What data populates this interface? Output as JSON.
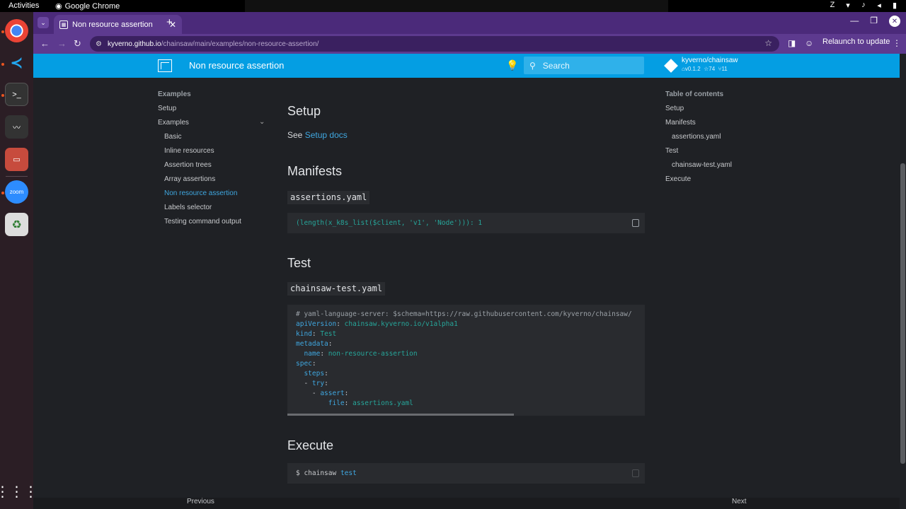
{
  "system_bar": {
    "activities": "Activities",
    "app_name": "Google Chrome"
  },
  "dock": {
    "apps": [
      "chrome-icon",
      "vscode-icon",
      "terminal-icon",
      "system-monitor-icon",
      "files-icon",
      "zoom-icon",
      "trash-icon",
      "show-apps-icon"
    ],
    "zoom_label": "zoom"
  },
  "browser": {
    "tab_title": "Non resource assertion",
    "url_host": "kyverno.github.io",
    "url_path": "/chainsaw/main/examples/non-resource-assertion/",
    "relaunch_label": "Relaunch to update"
  },
  "header": {
    "title": "Non resource assertion",
    "search_placeholder": "Search",
    "repo_name": "kyverno/chainsaw",
    "repo_version": "v0.1.2",
    "repo_stars": "74",
    "repo_forks": "11"
  },
  "left_nav": {
    "section": "Examples",
    "setup": "Setup",
    "examples": "Examples",
    "items": [
      {
        "label": "Basic"
      },
      {
        "label": "Inline resources"
      },
      {
        "label": "Assertion trees"
      },
      {
        "label": "Array assertions"
      },
      {
        "label": "Non resource assertion",
        "active": true
      },
      {
        "label": "Labels selector"
      },
      {
        "label": "Testing command output"
      }
    ]
  },
  "toc": {
    "title": "Table of contents",
    "items": [
      {
        "label": "Setup"
      },
      {
        "label": "Manifests"
      },
      {
        "label": "assertions.yaml",
        "sub": true
      },
      {
        "label": "Test"
      },
      {
        "label": "chainsaw-test.yaml",
        "sub": true
      },
      {
        "label": "Execute"
      }
    ]
  },
  "content": {
    "setup_heading": "Setup",
    "setup_text": "See",
    "setup_link": "Setup docs",
    "manifests_heading": "Manifests",
    "assertions_file": "assertions.yaml",
    "assertions_code": "(length(x_k8s_list($client, 'v1', 'Node'))): 1",
    "test_heading": "Test",
    "test_file": "chainsaw-test.yaml",
    "test_code": {
      "comment": "# yaml-language-server: $schema=https://raw.githubusercontent.com/kyverno/chainsaw/",
      "apiVersion_key": "apiVersion",
      "apiVersion_val": "chainsaw.kyverno.io/v1alpha1",
      "kind_key": "kind",
      "kind_val": "Test",
      "metadata_key": "metadata",
      "name_key": "name",
      "name_val": "non-resource-assertion",
      "spec_key": "spec",
      "steps_key": "steps",
      "try_key": "try",
      "assert_key": "assert",
      "file_key": "file",
      "file_val": "assertions.yaml"
    },
    "execute_heading": "Execute",
    "execute_cmd": "chainsaw",
    "execute_arg": "test"
  },
  "footer": {
    "previous": "Previous",
    "next": "Next"
  },
  "colors": {
    "header_bg": "#049ee3",
    "link": "#3fa7e0",
    "tab_strip": "#4b2a7a"
  }
}
